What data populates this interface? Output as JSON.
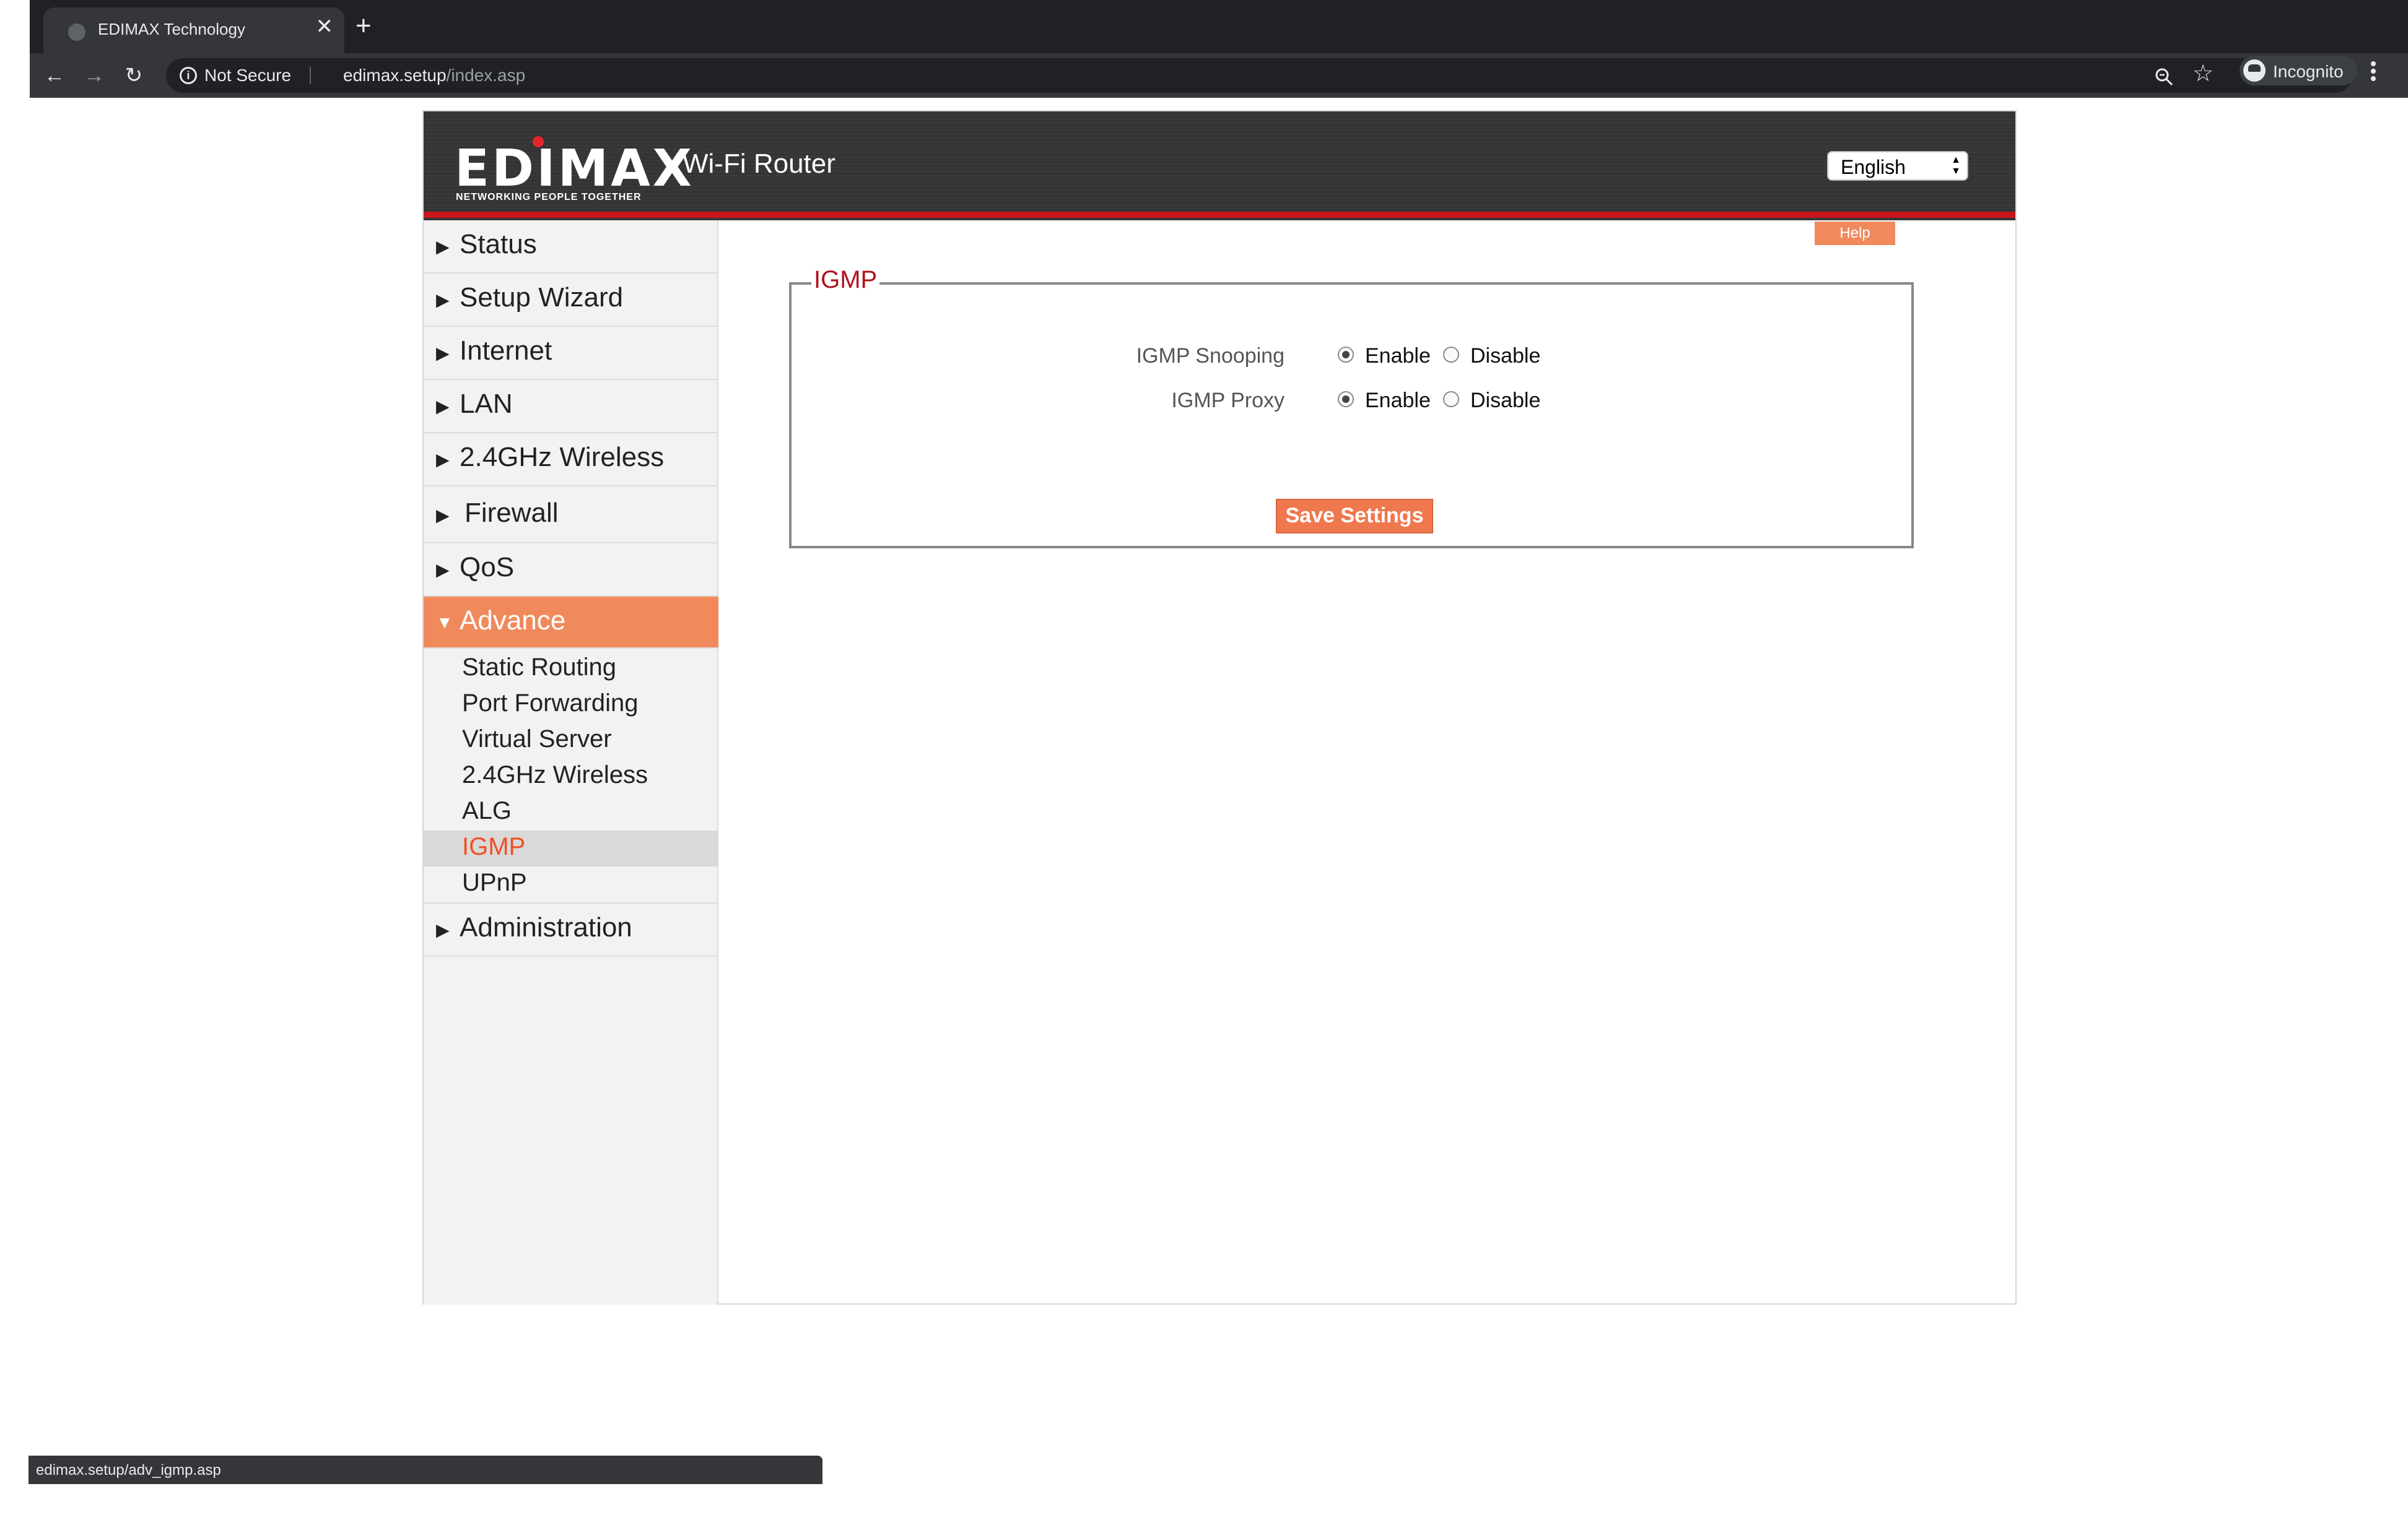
{
  "browser": {
    "tab_title": "EDIMAX Technology",
    "tab_close": "✕",
    "new_tab": "+",
    "back": "←",
    "forward": "→",
    "reload": "↻",
    "security_label": "Not Secure",
    "url_host": "edimax.setup",
    "url_path": "/index.asp",
    "bookmark": "☆",
    "profile_label": "Incognito",
    "status_url": "edimax.setup/adv_igmp.asp"
  },
  "header": {
    "logo_text": "EDIMAX",
    "logo_tagline": "NETWORKING PEOPLE TOGETHER",
    "app_title": "Wi-Fi Router",
    "language": "English"
  },
  "sidebar": {
    "collapsed_arrow": "▶",
    "expanded_arrow": "▼",
    "items": [
      {
        "label": "Status"
      },
      {
        "label": "Setup Wizard"
      },
      {
        "label": "Internet"
      },
      {
        "label": "LAN"
      },
      {
        "label": "2.4GHz Wireless"
      },
      {
        "label": "Firewall"
      },
      {
        "label": "QoS"
      },
      {
        "label": "Advance"
      },
      {
        "label": "Administration"
      }
    ],
    "advance_subitems": [
      {
        "label": "Static Routing"
      },
      {
        "label": "Port Forwarding"
      },
      {
        "label": "Virtual Server"
      },
      {
        "label": "2.4GHz Wireless"
      },
      {
        "label": "ALG"
      },
      {
        "label": "IGMP"
      },
      {
        "label": "UPnP"
      }
    ]
  },
  "content": {
    "help_label": "Help",
    "section_title": "IGMP",
    "rows": [
      {
        "label": "IGMP  Snooping",
        "enable": "Enable",
        "disable": "Disable",
        "selected": "Enable"
      },
      {
        "label": "IGMP  Proxy",
        "enable": "Enable",
        "disable": "Disable",
        "selected": "Enable"
      }
    ],
    "save_label": "Save Settings"
  },
  "colors": {
    "accent": "#f08a5d",
    "active_sub": "#f04e23",
    "legend": "#b0111d",
    "header_bg": "#343434",
    "header_line": "#c9161c"
  }
}
